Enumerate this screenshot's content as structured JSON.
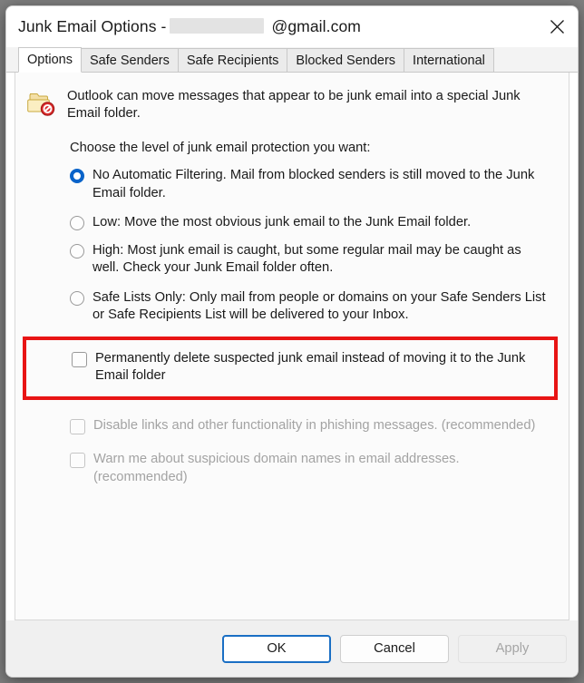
{
  "window": {
    "title_prefix": "Junk Email Options -",
    "account_redacted": "",
    "account_domain": "@gmail.com",
    "close_icon": "close-icon"
  },
  "tabs": [
    {
      "label": "Options",
      "active": true
    },
    {
      "label": "Safe Senders",
      "active": false
    },
    {
      "label": "Safe Recipients",
      "active": false
    },
    {
      "label": "Blocked Senders",
      "active": false
    },
    {
      "label": "International",
      "active": false
    }
  ],
  "content": {
    "icon": "junk-folder-icon",
    "intro": "Outlook can move messages that appear to be junk email into a special Junk Email folder.",
    "subhead": "Choose the level of junk email protection you want:",
    "protection_levels": [
      {
        "label": "No Automatic Filtering. Mail from blocked senders is still moved to the Junk Email folder.",
        "selected": true
      },
      {
        "label": "Low: Move the most obvious junk email to the Junk Email folder.",
        "selected": false
      },
      {
        "label": "High: Most junk email is caught, but some regular mail may be caught as well. Check your Junk Email folder often.",
        "selected": false
      },
      {
        "label": "Safe Lists Only: Only mail from people or domains on your Safe Senders List or Safe Recipients List will be delivered to your Inbox.",
        "selected": false
      }
    ],
    "highlighted_checkbox": {
      "label": "Permanently delete suspected junk email instead of moving it to the Junk Email folder",
      "checked": false,
      "disabled": false
    },
    "other_checkboxes": [
      {
        "label": "Disable links and other functionality in phishing messages. (recommended)",
        "checked": false,
        "disabled": true
      },
      {
        "label": "Warn me about suspicious domain names in email addresses. (recommended)",
        "checked": false,
        "disabled": true
      }
    ]
  },
  "footer": {
    "ok_label": "OK",
    "cancel_label": "Cancel",
    "apply_label": "Apply"
  },
  "colors": {
    "accent": "#0a63c9",
    "highlight": "#e81414",
    "default_button_border": "#1a6fc4"
  }
}
